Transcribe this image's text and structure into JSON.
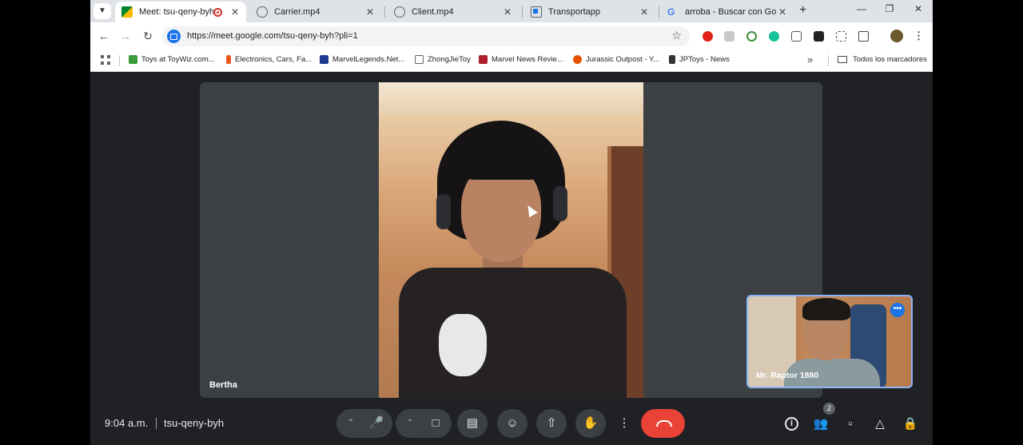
{
  "browser": {
    "tabs": [
      {
        "title": "Meet: tsu-qeny-byh",
        "active": true,
        "recording": true
      },
      {
        "title": "Carrier.mp4"
      },
      {
        "title": "Client.mp4"
      },
      {
        "title": "Transportapp"
      },
      {
        "title": "arroba - Buscar con Google"
      }
    ],
    "url": "https://meet.google.com/tsu-qeny-byh?pli=1",
    "bookmarks": [
      "Toys at ToyWiz.com...",
      "Electronics, Cars, Fa...",
      "MarvelLegends.Net...",
      "ZhongJieToy",
      "Marvel News Revie...",
      "Jurassic Outpost - Y...",
      "JPToys - News"
    ],
    "all_bookmarks": "Todos los marcadores",
    "icons": {
      "back": "arrow-left-icon",
      "forward": "arrow-right-icon",
      "reload": "reload-icon",
      "star": "star-icon",
      "tab_search": "chevron-down-icon",
      "new_tab": "plus-icon",
      "minimize": "minimize-icon",
      "restore": "restore-icon",
      "close": "close-icon"
    }
  },
  "meet": {
    "main_participant": "Bertha",
    "self_participant": "Mr. Raptor 1880",
    "time": "9:04 a.m.",
    "meeting_code": "tsu-qeny-byh",
    "participant_count": "2",
    "controls": [
      "microphone",
      "camera",
      "captions",
      "emoji",
      "present",
      "raise-hand",
      "more-options",
      "end-call"
    ],
    "right_controls": [
      "meeting-info",
      "people",
      "chat",
      "activities",
      "host-controls"
    ],
    "colors": {
      "end_call": "#ea4335",
      "self_border": "#8ab4f8",
      "background": "#202124"
    }
  }
}
